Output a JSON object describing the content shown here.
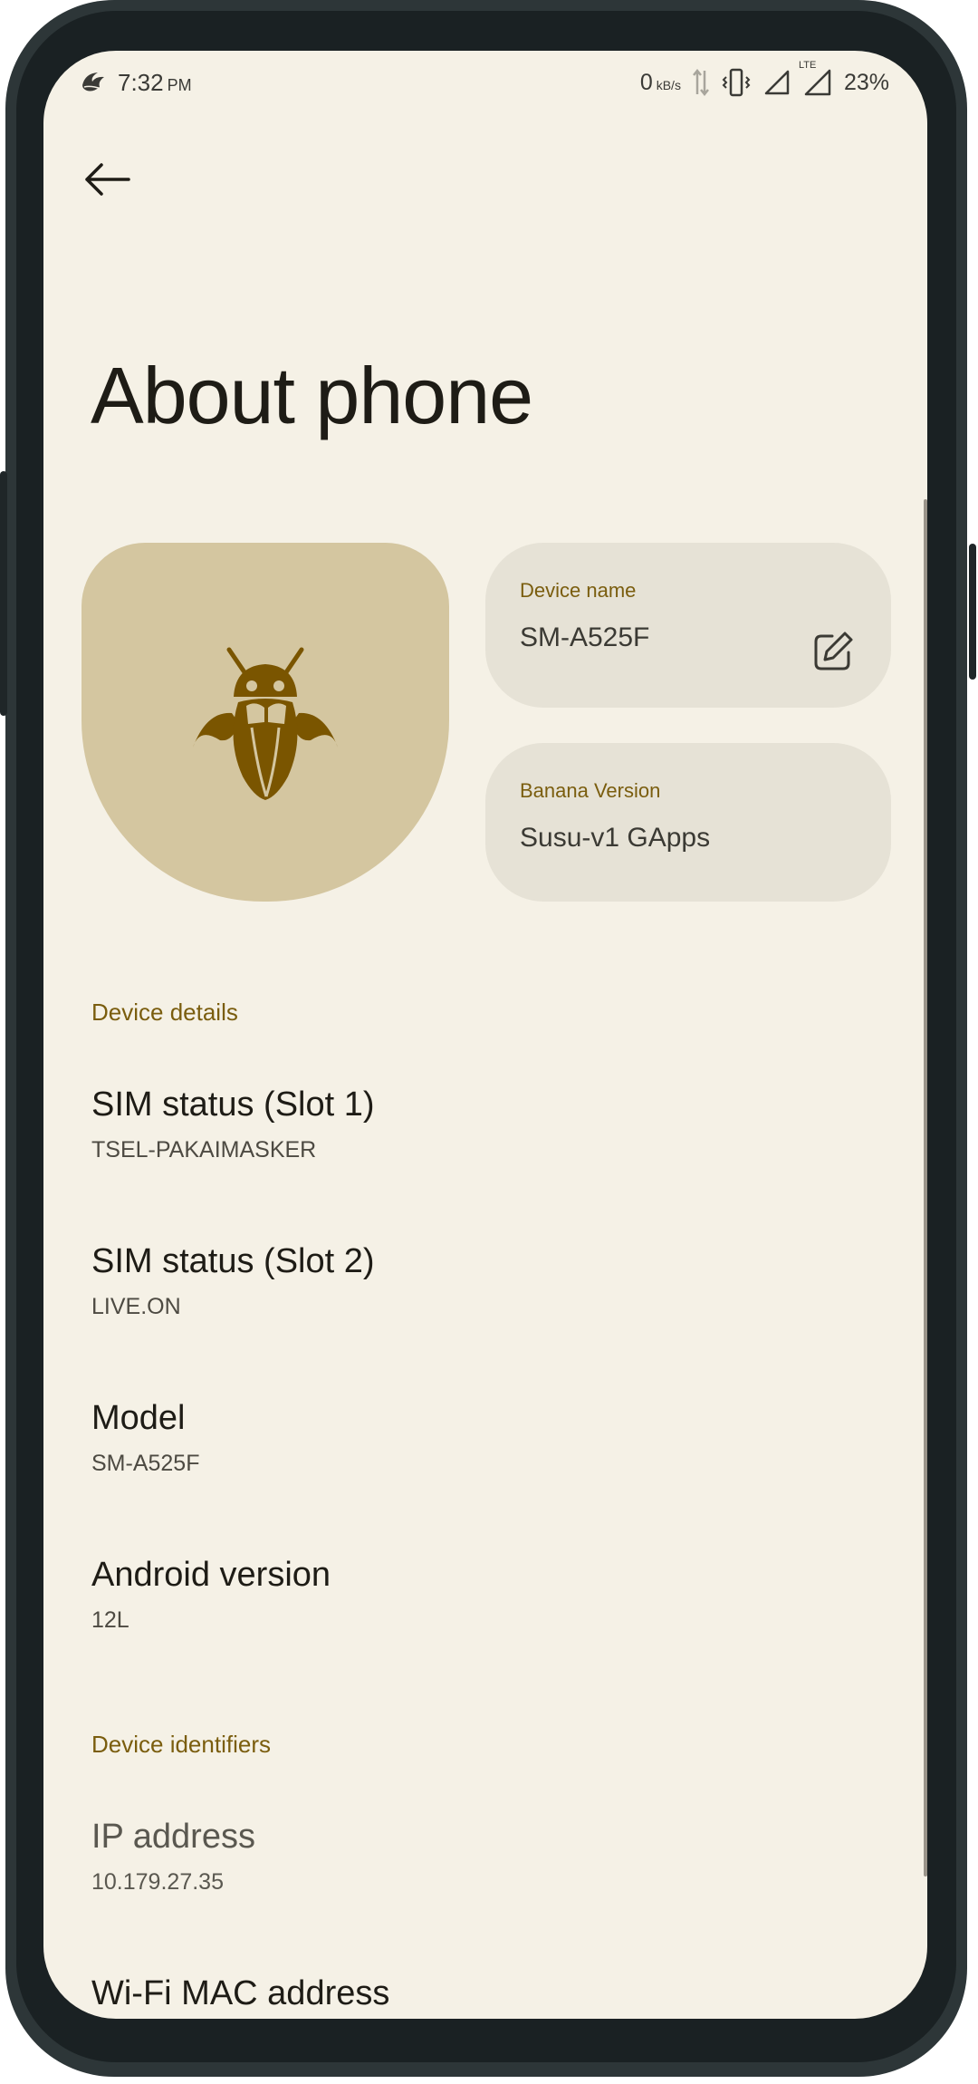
{
  "status_bar": {
    "time": "7:32",
    "ampm": "PM",
    "net_speed": "0",
    "net_unit": "kB/s",
    "network_type": "LTE",
    "battery": "23%",
    "icons": [
      "app-notification-icon",
      "data-activity-icon",
      "vibrate-icon",
      "signal-icon",
      "lte-signal-icon"
    ]
  },
  "toolbar": {
    "back_icon": "arrow-back-icon"
  },
  "page": {
    "title": "About phone"
  },
  "hero": {
    "icon": "bug-mascot-icon",
    "color": "#d4c6a0",
    "icon_color": "#7a5500"
  },
  "cards": {
    "device_name": {
      "label": "Device name",
      "value": "SM-A525F",
      "action_icon": "edit-icon"
    },
    "banana_version": {
      "label": "Banana Version",
      "value": "Susu-v1 GApps"
    }
  },
  "sections": {
    "device_details": {
      "header": "Device details",
      "items": [
        {
          "title": "SIM status (Slot 1)",
          "summary": "TSEL-PAKAIMASKER"
        },
        {
          "title": "SIM status (Slot 2)",
          "summary": "LIVE.ON"
        },
        {
          "title": "Model",
          "summary": "SM-A525F"
        },
        {
          "title": "Android version",
          "summary": "12L"
        }
      ]
    },
    "device_identifiers": {
      "header": "Device identifiers",
      "items": [
        {
          "title": "IP address",
          "summary": "10.179.27.35"
        },
        {
          "title": "Wi-Fi MAC address",
          "summary": ""
        }
      ]
    }
  },
  "colors": {
    "background": "#f5f1e6",
    "accent": "#7a5d0e",
    "card": "#e6e2d6",
    "text_primary": "#1e1c16",
    "frame": "#2d3638"
  }
}
